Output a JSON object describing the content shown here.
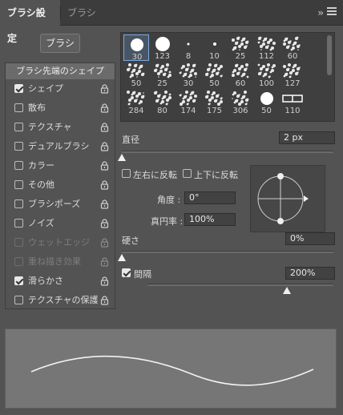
{
  "tabs": {
    "active": "ブラシ設定",
    "inactive": "ブラシ"
  },
  "brush_button": "ブラシ",
  "sidebar": {
    "header": "ブラシ先端のシェイプ",
    "items": [
      {
        "label": "シェイプ",
        "checked": true,
        "enabled": true
      },
      {
        "label": "散布",
        "checked": false,
        "enabled": true
      },
      {
        "label": "テクスチャ",
        "checked": false,
        "enabled": true
      },
      {
        "label": "デュアルブラシ",
        "checked": false,
        "enabled": true
      },
      {
        "label": "カラー",
        "checked": false,
        "enabled": true
      },
      {
        "label": "その他",
        "checked": false,
        "enabled": true
      },
      {
        "label": "ブラシポーズ",
        "checked": false,
        "enabled": true
      },
      {
        "label": "ノイズ",
        "checked": false,
        "enabled": true
      },
      {
        "label": "ウェットエッジ",
        "checked": false,
        "enabled": false
      },
      {
        "label": "重ね描き効果",
        "checked": false,
        "enabled": false
      },
      {
        "label": "滑らかさ",
        "checked": true,
        "enabled": true
      },
      {
        "label": "テクスチャの保護",
        "checked": false,
        "enabled": true
      }
    ]
  },
  "brush_presets": [
    "30",
    "123",
    "8",
    "10",
    "25",
    "112",
    "60",
    "50",
    "25",
    "30",
    "50",
    "60",
    "100",
    "127",
    "284",
    "80",
    "174",
    "175",
    "306",
    "50",
    "110"
  ],
  "settings": {
    "diameter_label": "直径",
    "diameter_value": "2 px",
    "diameter_level": 0.0,
    "flip_x_label": "左右に反転",
    "flip_y_label": "上下に反転",
    "flip_x_checked": false,
    "flip_y_checked": false,
    "angle_label": "角度 :",
    "angle_value": "0°",
    "roundness_label": "真円率 :",
    "roundness_value": "100%",
    "hardness_label": "硬さ",
    "hardness_value": "0%",
    "hardness_level": 0.0,
    "spacing_label": "間隔",
    "spacing_checked": true,
    "spacing_value": "200%",
    "spacing_level": 0.75
  }
}
